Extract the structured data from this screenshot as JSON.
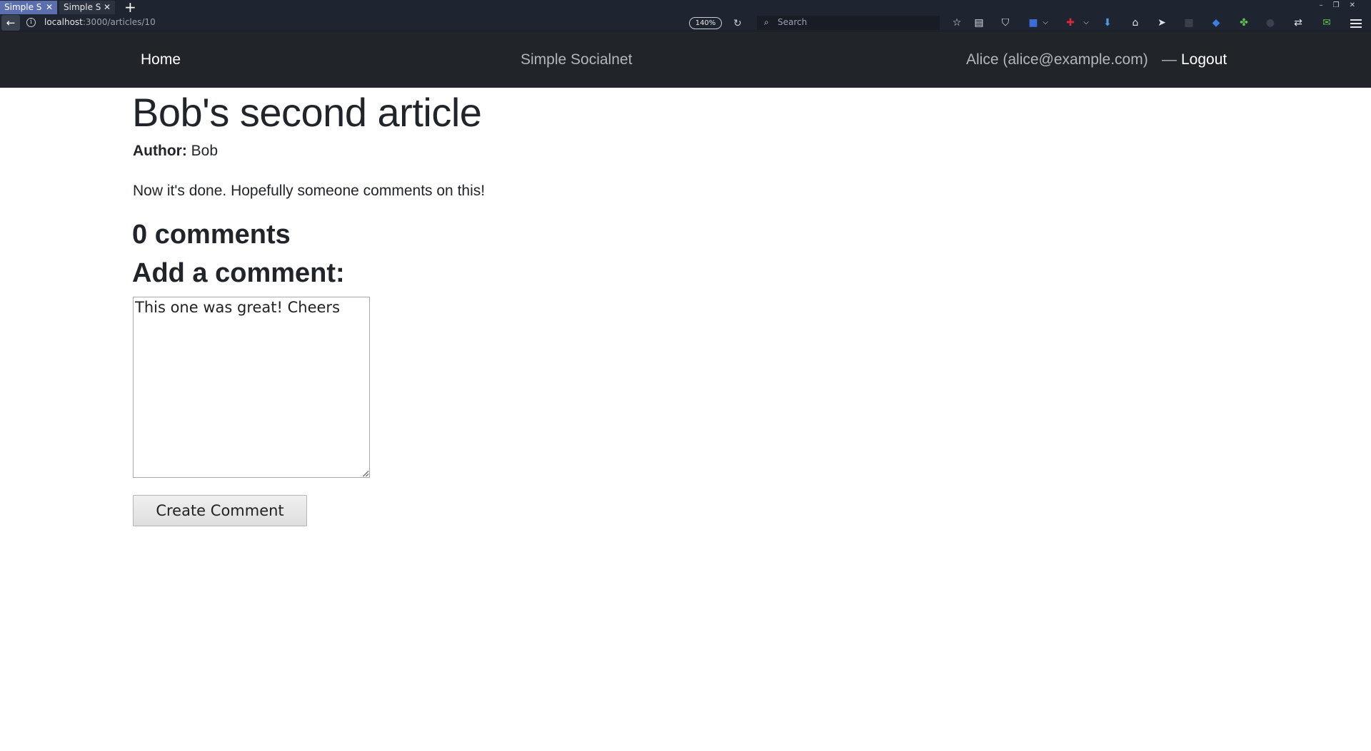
{
  "browser": {
    "tabs": [
      {
        "label": "Simple Socialnet",
        "active": true
      },
      {
        "label": "Simple Socialnet",
        "active": false
      }
    ],
    "new_tab_label": "+",
    "url_host": "localhost",
    "url_path": ":3000/articles/10",
    "zoom": "140%",
    "search_placeholder": "Search",
    "toolbar_icons": [
      "star-icon",
      "reading-list-icon",
      "pocket-icon",
      "bookmark-icon",
      "container-icon",
      "download-icon",
      "home-icon",
      "send-icon",
      "grid-icon",
      "extension-icon",
      "puzzle-icon",
      "sync-icon",
      "notification-icon",
      "menu-icon"
    ]
  },
  "header": {
    "home_label": "Home",
    "brand": "Simple Socialnet",
    "user": "Alice (alice@example.com)",
    "separator": "—",
    "logout_label": "Logout"
  },
  "article": {
    "title": "Bob's second article",
    "author_label": "Author:",
    "author": "Bob",
    "body": "Now it's done. Hopefully someone comments on this!"
  },
  "comments": {
    "count_heading": "0 comments",
    "add_heading": "Add a comment:",
    "textarea_value": "This one was great! Cheers",
    "submit_label": "Create Comment"
  },
  "colors": {
    "header_bg": "#212529",
    "text": "#212529",
    "muted_nav": "#b3b7bc"
  }
}
